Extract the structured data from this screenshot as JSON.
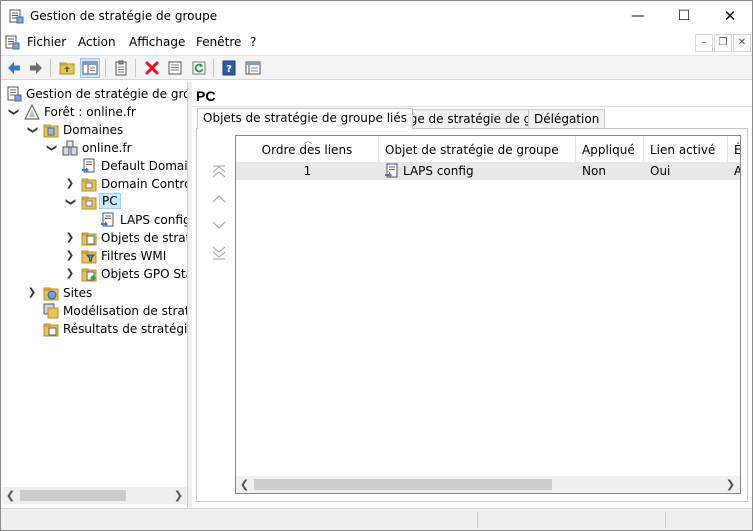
{
  "window": {
    "title": "Gestion de stratégie de groupe",
    "controls": {
      "minimize": "—",
      "maximize": "☐",
      "close": "✕"
    }
  },
  "menu": {
    "items": [
      "Fichier",
      "Action",
      "Affichage",
      "Fenêtre",
      "?"
    ],
    "mdi_controls": {
      "minimize": "–",
      "restore": "❐",
      "close": "✕"
    }
  },
  "toolbar": {
    "buttons": [
      "back-icon",
      "forward-icon",
      "up-folder-icon",
      "show-hide-tree-icon",
      "properties-icon",
      "delete-icon",
      "export-list-icon",
      "refresh-icon",
      "help-icon",
      "details-view-icon"
    ]
  },
  "tree": {
    "items": [
      {
        "label": "Gestion de stratégie de groupe",
        "icon": "gpmc-icon",
        "expander": ""
      },
      {
        "label": "Forêt : online.fr",
        "icon": "forest-icon",
        "expander": "expanded"
      },
      {
        "label": "Domaines",
        "icon": "domains-folder-icon",
        "expander": "expanded"
      },
      {
        "label": "online.fr",
        "icon": "domain-icon",
        "expander": "expanded"
      },
      {
        "label": "Default Domain",
        "icon": "gpo-link-icon",
        "expander": ""
      },
      {
        "label": "Domain Contro",
        "icon": "ou-icon",
        "expander": "collapsed"
      },
      {
        "label": "PC",
        "icon": "ou-icon",
        "expander": "expanded"
      },
      {
        "label": "LAPS config",
        "icon": "gpo-link-icon",
        "expander": ""
      },
      {
        "label": "Objets de straté",
        "icon": "gpo-folder-icon",
        "expander": "collapsed"
      },
      {
        "label": "Filtres WMI",
        "icon": "wmi-folder-icon",
        "expander": "collapsed"
      },
      {
        "label": "Objets GPO Star",
        "icon": "starter-gpo-folder-icon",
        "expander": "collapsed"
      },
      {
        "label": "Sites",
        "icon": "sites-folder-icon",
        "expander": "collapsed"
      },
      {
        "label": "Modélisation de stratég",
        "icon": "modeling-icon",
        "expander": ""
      },
      {
        "label": "Résultats de stratégie d",
        "icon": "results-icon",
        "expander": ""
      }
    ],
    "selected": "PC",
    "scroll_left": "❮",
    "scroll_right": "❯"
  },
  "right": {
    "title": "PC",
    "tabs": [
      "Objets de stratégie de groupe liés",
      "Héritage de stratégie de groupe",
      "Délégation"
    ],
    "active_tab": 0,
    "order_buttons": [
      "move-top-icon",
      "move-up-icon",
      "move-down-icon",
      "move-bottom-icon"
    ],
    "columns": [
      "Ordre des liens",
      "Objet de stratégie de groupe",
      "Appliqué",
      "Lien activé",
      "É"
    ],
    "rows": [
      {
        "order": "1",
        "gpo": "LAPS config",
        "enforced": "Non",
        "enabled": "Oui",
        "status": "A"
      }
    ],
    "scroll_left": "❮",
    "scroll_right": "❯"
  },
  "colors": {
    "selection_bg": "#cce8ff",
    "row_bg": "#e8e8e8",
    "delete_red": "#e81123",
    "help_blue": "#2a5caa"
  }
}
